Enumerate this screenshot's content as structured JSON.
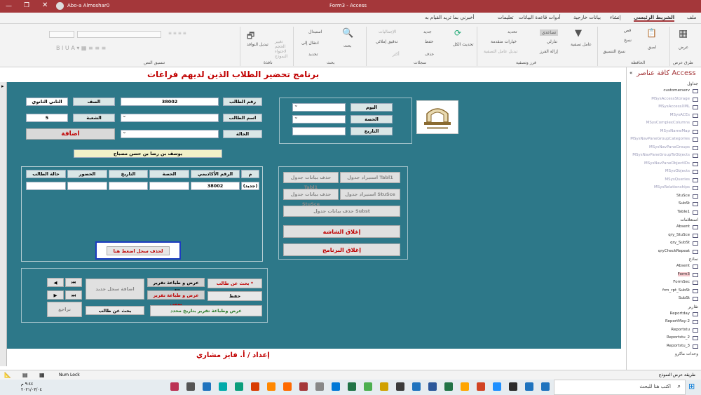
{
  "window": {
    "title": "Form3 - Access",
    "user": "Abo-a Almoshar0",
    "tell_me": "أخبرني بما تريد القيام به"
  },
  "tabs": [
    "ملف",
    "الشريط الرئيسي",
    "إنشاء",
    "بيانات خارجية",
    "أدوات قاعدة البيانات",
    "تعليمات"
  ],
  "ribbon": {
    "views": "عرض",
    "views_group": "طرق عرض",
    "paste": "لصق",
    "cut": "قص",
    "copy": "نسخ",
    "format_painter": "نسخ التنسيق",
    "clipboard": "الحافظة",
    "filter": "عامل تصفية",
    "ascending": "تصاعدي",
    "descending": "تنازلي",
    "remove_sort": "إزالة الفرز",
    "selection": "تحديد",
    "advanced": "خيارات متقدمة",
    "toggle_filter": "تبديل عامل التصفية",
    "sort_filter": "فرز وتصفية",
    "refresh": "تحديث الكل",
    "new": "جديد",
    "save": "حفظ",
    "delete": "حذف",
    "totals": "الإجماليات",
    "spelling": "تدقيق إملائي",
    "more": "أكثر",
    "records": "سجلات",
    "find": "بحث",
    "replace": "استبدال",
    "goto": "انتقال إلى",
    "select": "تحديد",
    "find_group": "بحث",
    "size_to_fit": "تغيير الحجم لاحتواء النموذج",
    "switch_windows": "تبديل النوافذ",
    "window_group": "نافذة",
    "text_format": "تنسيق النص"
  },
  "form": {
    "title": "برنامج تحضير الطلاب الذين لديهم فراغات",
    "footer": "إعداد / أ. فايز مشاري",
    "labels": {
      "student_no": "رقم الطالب",
      "grade": "الصف",
      "student_name": "اسم الطالب",
      "section": "الشعبة",
      "status": "الحالة",
      "day": "اليوم",
      "period": "الحصة",
      "date": "التاريخ"
    },
    "values": {
      "student_no": "38002",
      "grade": "الثاني الثانوي",
      "section": "5",
      "add": "اضافة",
      "student_fullname": "يوسف بن رضا بن حسن مصباح"
    },
    "table": {
      "headers": [
        "م",
        "الرقم الأكاديمي",
        "الحصة",
        "التاريخ",
        "الحضور",
        "حالة الطالب"
      ],
      "row": [
        "(جديد)",
        "38002",
        "",
        "",
        "",
        ""
      ]
    },
    "delete_record": "لحذف سجل اضغط هنا",
    "right_buttons": [
      "استيراد جدول Tabl1",
      "حذف بيانات جدول Tabl1",
      "استيراد جدول StuSce",
      "حذف بيانات جدول StuSce",
      "حذف بيانات جدول Subst",
      "إغلاق الشاشة",
      "إغلاق البرنامج"
    ],
    "bottom": {
      "search_student": "بحث عن طالب *",
      "print_student": "عرض و طباعة تقرير طالب",
      "save": "حفظ",
      "print_daily": "عرض و طباعة تقرير يومي",
      "print_date": "عرض وطباعة تقرير بتاريخ محدد",
      "search_student2": "بحث عن طالب",
      "add_new": "اضافة سجل جديد",
      "undo": "تراجع"
    }
  },
  "nav": {
    "title": "كافة عناصر Access",
    "search": "بحث...",
    "groups": [
      {
        "name": "جداول",
        "items": [
          "customerserv",
          "MSysAccessStorage",
          "MSysAccessXML",
          "MSysACEs",
          "MSysComplexColumns",
          "MSysNameMap",
          "MSysNavPaneGroupCategories",
          "MSysNavPaneGroups",
          "MSysNavPaneGroupToObjects",
          "MSysNavPaneObjectIDs",
          "MSysObjects",
          "MSysQueries",
          "MSysRelationships",
          "StuSce",
          "SubSt",
          "Table1"
        ]
      },
      {
        "name": "استعلامات",
        "items": [
          "Absent",
          "qry_StuSce",
          "qry_SubSt",
          "qryCheckRepeat"
        ]
      },
      {
        "name": "نماذج",
        "items": [
          "Absent",
          "Form3",
          "FormSec",
          "frm_rpt_SubSt",
          "SubSt"
        ]
      },
      {
        "name": "تقارير",
        "items": [
          "Reportday",
          "ReportMay-2",
          "Reportstu",
          "Reportstu_2",
          "Reportstu_3"
        ]
      },
      {
        "name": "وحدات ماكرو",
        "items": []
      }
    ]
  },
  "status": {
    "left": "طريقة عرض النموذج",
    "num_lock": "Num Lock"
  },
  "taskbar": {
    "search": "اكتب هنا للبحث",
    "time": "٩:٤٤ م",
    "date": "٢٠٢١/٠٣/٠٤"
  }
}
